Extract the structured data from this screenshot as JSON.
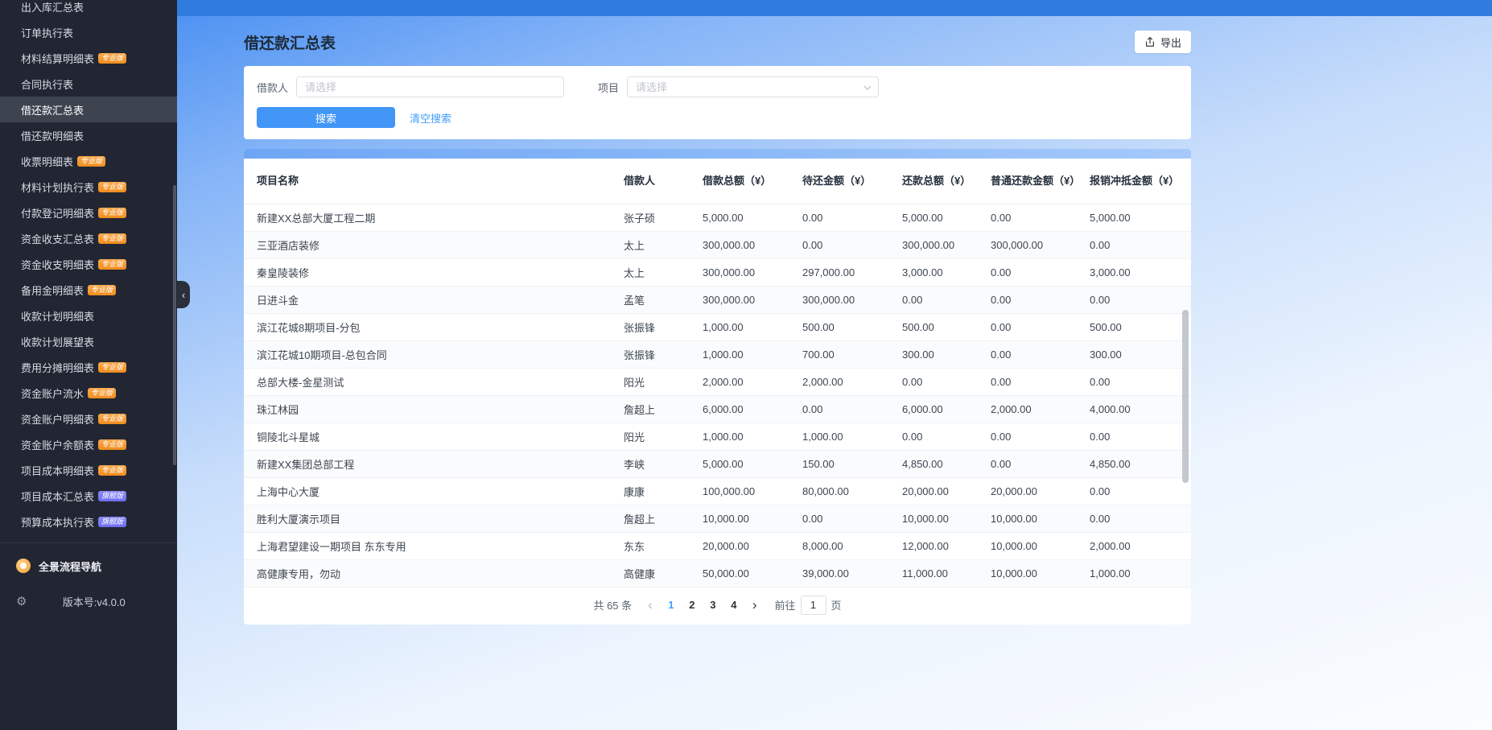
{
  "sidebar": {
    "items": [
      {
        "label": "出入库汇总表"
      },
      {
        "label": "订单执行表"
      },
      {
        "label": "材料结算明细表",
        "badge": "专业版",
        "badge_type": "pro"
      },
      {
        "label": "合同执行表"
      },
      {
        "label": "借还款汇总表",
        "active": true
      },
      {
        "label": "借还款明细表"
      },
      {
        "label": "收票明细表",
        "badge": "专业版",
        "badge_type": "pro"
      },
      {
        "label": "材料计划执行表",
        "badge": "专业版",
        "badge_type": "pro"
      },
      {
        "label": "付款登记明细表",
        "badge": "专业版",
        "badge_type": "pro"
      },
      {
        "label": "资金收支汇总表",
        "badge": "专业版",
        "badge_type": "pro"
      },
      {
        "label": "资金收支明细表",
        "badge": "专业版",
        "badge_type": "pro"
      },
      {
        "label": "备用金明细表",
        "badge": "专业版",
        "badge_type": "pro"
      },
      {
        "label": "收款计划明细表"
      },
      {
        "label": "收款计划展望表"
      },
      {
        "label": "费用分摊明细表",
        "badge": "专业版",
        "badge_type": "pro"
      },
      {
        "label": "资金账户流水",
        "badge": "专业版",
        "badge_type": "pro"
      },
      {
        "label": "资金账户明细表",
        "badge": "专业版",
        "badge_type": "pro"
      },
      {
        "label": "资金账户余额表",
        "badge": "专业版",
        "badge_type": "pro"
      },
      {
        "label": "项目成本明细表",
        "badge": "专业版",
        "badge_type": "pro"
      },
      {
        "label": "项目成本汇总表",
        "badge": "旗舰版",
        "badge_type": "flagship"
      },
      {
        "label": "预算成本执行表",
        "badge": "旗舰版",
        "badge_type": "flagship"
      }
    ],
    "footer": {
      "nav_label": "全景流程导航",
      "gear_icon": "⚙",
      "version": "版本号:v4.0.0"
    },
    "collapse_icon": "‹"
  },
  "page": {
    "title": "借还款汇总表",
    "export_label": "导出"
  },
  "filters": {
    "borrower_label": "借款人",
    "borrower_placeholder": "请选择",
    "project_label": "项目",
    "project_placeholder": "请选择",
    "search_label": "搜索",
    "clear_label": "清空搜索"
  },
  "table": {
    "columns": [
      "项目名称",
      "借款人",
      "借款总额（¥）",
      "待还金额（¥）",
      "还款总额（¥）",
      "普通还款金额（¥）",
      "报销冲抵金额（¥）"
    ],
    "rows": [
      [
        "新建XX总部大厦工程二期",
        "张子硕",
        "5,000.00",
        "0.00",
        "5,000.00",
        "0.00",
        "5,000.00"
      ],
      [
        "三亚酒店装修",
        "太上",
        "300,000.00",
        "0.00",
        "300,000.00",
        "300,000.00",
        "0.00"
      ],
      [
        "秦皇陵装修",
        "太上",
        "300,000.00",
        "297,000.00",
        "3,000.00",
        "0.00",
        "3,000.00"
      ],
      [
        "日进斗金",
        "孟笔",
        "300,000.00",
        "300,000.00",
        "0.00",
        "0.00",
        "0.00"
      ],
      [
        "滨江花城8期项目-分包",
        "张振锋",
        "1,000.00",
        "500.00",
        "500.00",
        "0.00",
        "500.00"
      ],
      [
        "滨江花城10期项目-总包合同",
        "张振锋",
        "1,000.00",
        "700.00",
        "300.00",
        "0.00",
        "300.00"
      ],
      [
        "总部大楼-金星测试",
        "阳光",
        "2,000.00",
        "2,000.00",
        "0.00",
        "0.00",
        "0.00"
      ],
      [
        "珠江林园",
        "詹超上",
        "6,000.00",
        "0.00",
        "6,000.00",
        "2,000.00",
        "4,000.00"
      ],
      [
        "铜陵北斗星城",
        "阳光",
        "1,000.00",
        "1,000.00",
        "0.00",
        "0.00",
        "0.00"
      ],
      [
        "新建XX集团总部工程",
        "李峡",
        "5,000.00",
        "150.00",
        "4,850.00",
        "0.00",
        "4,850.00"
      ],
      [
        "上海中心大厦",
        "康康",
        "100,000.00",
        "80,000.00",
        "20,000.00",
        "20,000.00",
        "0.00"
      ],
      [
        "胜利大厦演示项目",
        "詹超上",
        "10,000.00",
        "0.00",
        "10,000.00",
        "10,000.00",
        "0.00"
      ],
      [
        "上海君望建设一期项目 东东专用",
        "东东",
        "20,000.00",
        "8,000.00",
        "12,000.00",
        "10,000.00",
        "2,000.00"
      ],
      [
        "高健康专用，勿动",
        "高健康",
        "50,000.00",
        "39,000.00",
        "11,000.00",
        "10,000.00",
        "1,000.00"
      ]
    ]
  },
  "pagination": {
    "total_label": "共 65 条",
    "prev_icon": "‹",
    "next_icon": "›",
    "pages": [
      "1",
      "2",
      "3",
      "4"
    ],
    "active_page": "1",
    "goto_label": "前往",
    "goto_value": "1",
    "goto_suffix": "页"
  }
}
